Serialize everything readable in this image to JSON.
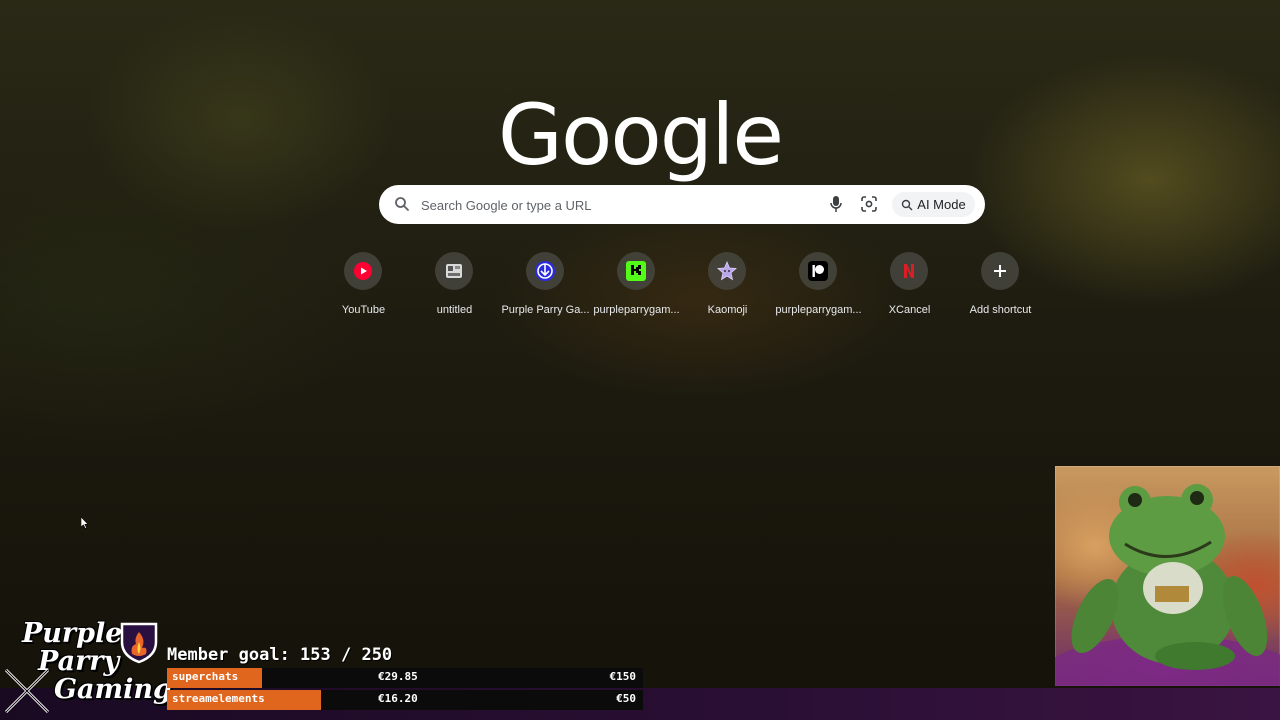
{
  "logo": {
    "text": "Google"
  },
  "search": {
    "placeholder": "Search Google or type a URL",
    "ai_mode_label": "AI Mode"
  },
  "shortcuts": [
    {
      "label": "YouTube",
      "icon": "youtube-icon"
    },
    {
      "label": "untitled",
      "icon": "untitled-icon"
    },
    {
      "label": "Purple Parry Ga...",
      "icon": "purple-parry-icon"
    },
    {
      "label": "purpleparrygam...",
      "icon": "kick-icon"
    },
    {
      "label": "Kaomoji",
      "icon": "kaomoji-icon"
    },
    {
      "label": "purpleparrygam...",
      "icon": "patreon-icon"
    },
    {
      "label": "XCancel",
      "icon": "xcancel-icon"
    },
    {
      "label": "Add shortcut",
      "icon": "plus-icon"
    }
  ],
  "overlay": {
    "brand": {
      "line1": "Purple",
      "line2": "Parry",
      "line3": "Gaming"
    },
    "member_goal": "Member goal: 153 / 250",
    "donations": [
      {
        "name": "superchats",
        "amount": "€29.85",
        "goal": "€150",
        "progress": 0.199
      },
      {
        "name": "streamelements",
        "amount": "€16.20",
        "goal": "€50",
        "progress": 0.324
      }
    ]
  },
  "colors": {
    "overlay_accent": "#e0661e",
    "youtube_red": "#ff0033",
    "kick_green": "#53fc18",
    "xcancel_red": "#d81f26"
  }
}
